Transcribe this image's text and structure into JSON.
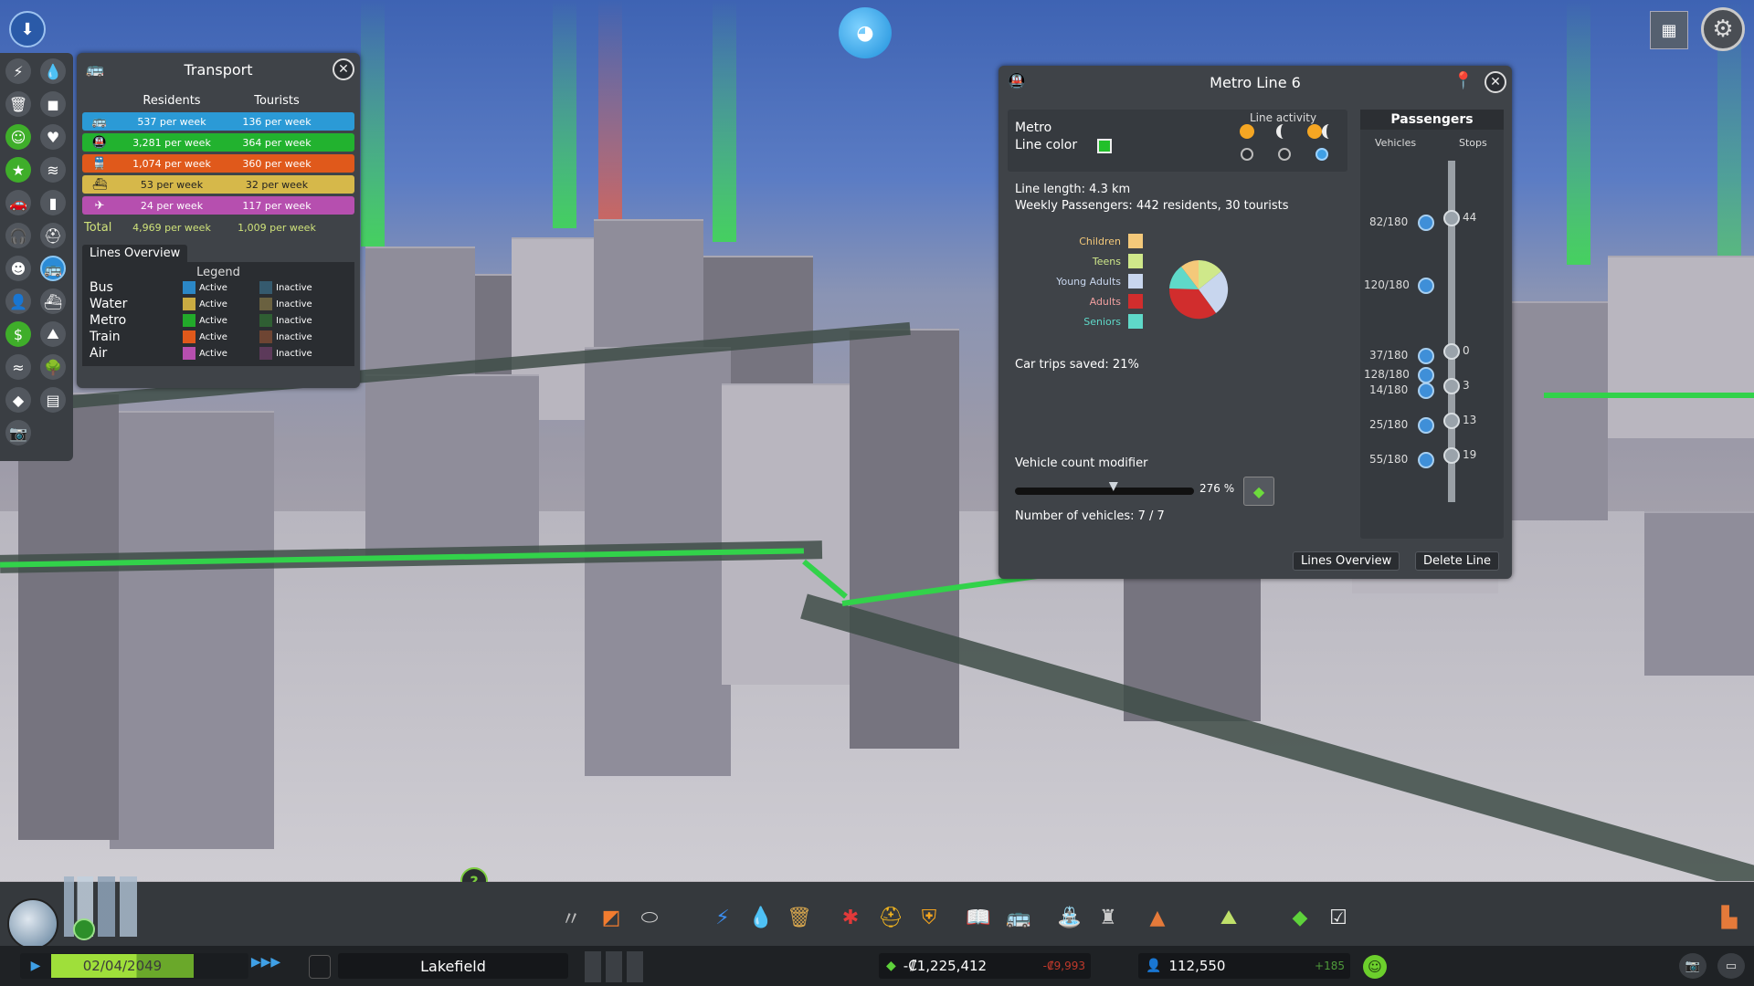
{
  "transport": {
    "title": "Transport",
    "col_residents": "Residents",
    "col_tourists": "Tourists",
    "rows": [
      {
        "name": "bus",
        "icon": "bus-icon",
        "glyph": "🚌",
        "residents": "537 per week",
        "tourists": "136 per week",
        "color": "#2b9ad6"
      },
      {
        "name": "metro",
        "icon": "metro-icon",
        "glyph": "🚇",
        "residents": "3,281 per week",
        "tourists": "364 per week",
        "color": "#22b22f"
      },
      {
        "name": "train",
        "icon": "train-icon",
        "glyph": "🚆",
        "residents": "1,074 per week",
        "tourists": "360 per week",
        "color": "#e0591b"
      },
      {
        "name": "ship",
        "icon": "ship-icon",
        "glyph": "⛴",
        "residents": "53 per week",
        "tourists": "32 per week",
        "color": "#d6b84a"
      },
      {
        "name": "air",
        "icon": "plane-icon",
        "glyph": "✈",
        "residents": "24 per week",
        "tourists": "117 per week",
        "color": "#b64faf"
      }
    ],
    "total_label": "Total",
    "total_residents": "4,969 per week",
    "total_tourists": "1,009 per week",
    "lines_overview_tab": "Lines Overview",
    "legend_title": "Legend",
    "legend": [
      {
        "name": "Bus",
        "active": "Active",
        "inactive": "Inactive",
        "active_color": "#2b87c6",
        "inactive_color": "#355a6e"
      },
      {
        "name": "Water",
        "active": "Active",
        "inactive": "Inactive",
        "active_color": "#c9ab42",
        "inactive_color": "#6a6140"
      },
      {
        "name": "Metro",
        "active": "Active",
        "inactive": "Inactive",
        "active_color": "#22aa2a",
        "inactive_color": "#2f5e33"
      },
      {
        "name": "Train",
        "active": "Active",
        "inactive": "Inactive",
        "active_color": "#e0591b",
        "inactive_color": "#6e4533"
      },
      {
        "name": "Air",
        "active": "Active",
        "inactive": "Inactive",
        "active_color": "#b64faf",
        "inactive_color": "#5c3a5a"
      }
    ]
  },
  "metro": {
    "title": "Metro Line 6",
    "type_label": "Metro",
    "line_color_label": "Line color",
    "line_color": "#22c02a",
    "line_activity_label": "Line activity",
    "line_length": "Line length: 4.3 km",
    "weekly_passengers": "Weekly Passengers: 442 residents, 30 tourists",
    "age_groups": [
      {
        "label": "Children",
        "color": "#f4c97a"
      },
      {
        "label": "Teens",
        "color": "#cfe88a"
      },
      {
        "label": "Young Adults",
        "color": "#c8d6ee"
      },
      {
        "label": "Adults",
        "color": "#d12d2d"
      },
      {
        "label": "Seniors",
        "color": "#5fd9c9"
      }
    ],
    "car_trips_saved": "Car trips saved: 21%",
    "vehicle_count_label": "Vehicle count modifier",
    "vehicle_count_value": "276 %",
    "vehicle_count_fraction": 0.55,
    "number_of_vehicles": "Number of vehicles: 7 / 7",
    "lines_overview_btn": "Lines Overview",
    "delete_line_btn": "Delete Line",
    "passengers_label": "Passengers",
    "vehicles_label": "Vehicles",
    "stops_label": "Stops",
    "vehicles": [
      "82/180",
      "120/180",
      "37/180",
      "128/180",
      "14/180",
      "25/180",
      "55/180"
    ],
    "stops": [
      "44",
      "0",
      "3",
      "13",
      "19"
    ]
  },
  "bottom": {
    "date": "02/04/2049",
    "city_name": "Lakefield",
    "money": "-₡1,225,412",
    "money_delta": "-₡9,993",
    "population": "112,550",
    "population_delta": "+185"
  },
  "help_glyph": "?"
}
